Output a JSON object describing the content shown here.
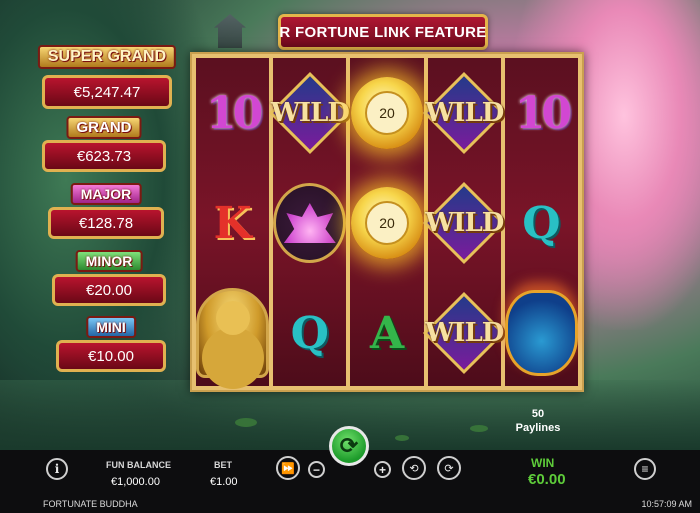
{
  "game": {
    "name": "FORTUNATE BUDDHA",
    "clock": "10:57:09 AM",
    "feature_banner": "R FORTUNE LINK FEATURE"
  },
  "jackpots": {
    "super_grand": {
      "title": "SUPER GRAND",
      "value": "€5,247.47"
    },
    "grand": {
      "title": "GRAND",
      "value": "€623.73"
    },
    "major": {
      "title": "MAJOR",
      "value": "€128.78"
    },
    "minor": {
      "title": "MINOR",
      "value": "€20.00"
    },
    "mini": {
      "title": "MINI",
      "value": "€10.00"
    }
  },
  "reels": {
    "reel1": [
      "10",
      "K",
      "buddha"
    ],
    "reel2": [
      "WILD",
      "lotus",
      "Q"
    ],
    "reel3": [
      "coin",
      "coin",
      "A"
    ],
    "reel4": [
      "WILD",
      "WILD",
      "WILD"
    ],
    "reel5": [
      "10",
      "Q",
      "money-bag"
    ],
    "coin_values": [
      "20",
      "20"
    ],
    "card_labels": {
      "ten": "10",
      "king": "K",
      "queen": "Q",
      "ace": "A",
      "wild": "WILD"
    }
  },
  "paylines": {
    "count": "50",
    "label": "Paylines"
  },
  "bottom_bar": {
    "balance_label": "FUN BALANCE",
    "balance_value": "€1,000.00",
    "bet_label": "BET",
    "bet_value": "€1.00",
    "win_label": "WIN",
    "win_value": "€0.00",
    "info_glyph": "i",
    "minus_glyph": "−",
    "plus_glyph": "+",
    "spin_glyph": "⟳",
    "menu_glyph": "≡",
    "autoplay_glyph": "⏩",
    "turbo_glyph": "⟲",
    "quickspin_glyph": "⟳"
  },
  "colors": {
    "win_green": "#5ecc3a",
    "jackpot_red": "#b8142e",
    "gold_border": "#e0b150",
    "spin_green": "#1c9a2a"
  },
  "icons": [
    "info-icon",
    "autoplay-icon",
    "minus-icon",
    "spin-icon",
    "plus-icon",
    "turbo-icon",
    "quickspin-icon",
    "menu-icon"
  ]
}
